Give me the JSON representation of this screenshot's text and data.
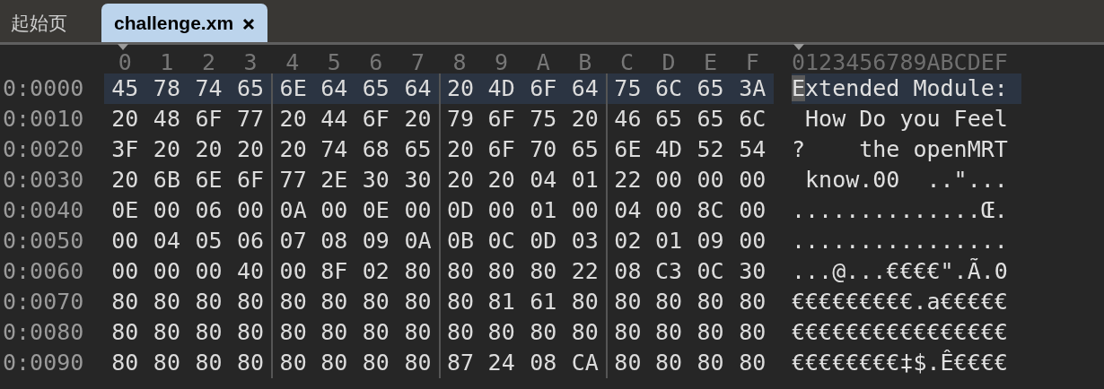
{
  "tabs": [
    {
      "label": "起始页",
      "selected": false,
      "closable": false
    },
    {
      "label": "challenge.xm",
      "selected": true,
      "closable": true
    }
  ],
  "column_headers": [
    "0",
    "1",
    "2",
    "3",
    "4",
    "5",
    "6",
    "7",
    "8",
    "9",
    "A",
    "B",
    "C",
    "D",
    "E",
    "F"
  ],
  "ascii_header": "0123456789ABCDEF",
  "rows": [
    {
      "address": "0:0000",
      "bytes": [
        "45",
        "78",
        "74",
        "65",
        "6E",
        "64",
        "65",
        "64",
        "20",
        "4D",
        "6F",
        "64",
        "75",
        "6C",
        "65",
        "3A"
      ],
      "ascii": "Extended Module:",
      "selected": true,
      "cursor": true
    },
    {
      "address": "0:0010",
      "bytes": [
        "20",
        "48",
        "6F",
        "77",
        "20",
        "44",
        "6F",
        "20",
        "79",
        "6F",
        "75",
        "20",
        "46",
        "65",
        "65",
        "6C"
      ],
      "ascii": " How Do you Feel",
      "selected": false,
      "cursor": false
    },
    {
      "address": "0:0020",
      "bytes": [
        "3F",
        "20",
        "20",
        "20",
        "20",
        "74",
        "68",
        "65",
        "20",
        "6F",
        "70",
        "65",
        "6E",
        "4D",
        "52",
        "54"
      ],
      "ascii": "?    the openMRT",
      "selected": false,
      "cursor": false
    },
    {
      "address": "0:0030",
      "bytes": [
        "20",
        "6B",
        "6E",
        "6F",
        "77",
        "2E",
        "30",
        "30",
        "20",
        "20",
        "04",
        "01",
        "22",
        "00",
        "00",
        "00"
      ],
      "ascii": " know.00  ..\"...",
      "selected": false,
      "cursor": false
    },
    {
      "address": "0:0040",
      "bytes": [
        "0E",
        "00",
        "06",
        "00",
        "0A",
        "00",
        "0E",
        "00",
        "0D",
        "00",
        "01",
        "00",
        "04",
        "00",
        "8C",
        "00"
      ],
      "ascii": "..............Œ.",
      "selected": false,
      "cursor": false
    },
    {
      "address": "0:0050",
      "bytes": [
        "00",
        "04",
        "05",
        "06",
        "07",
        "08",
        "09",
        "0A",
        "0B",
        "0C",
        "0D",
        "03",
        "02",
        "01",
        "09",
        "00"
      ],
      "ascii": "................",
      "selected": false,
      "cursor": false
    },
    {
      "address": "0:0060",
      "bytes": [
        "00",
        "00",
        "00",
        "40",
        "00",
        "8F",
        "02",
        "80",
        "80",
        "80",
        "80",
        "22",
        "08",
        "C3",
        "0C",
        "30"
      ],
      "ascii": "...@...€€€€\".Ã.0",
      "selected": false,
      "cursor": false
    },
    {
      "address": "0:0070",
      "bytes": [
        "80",
        "80",
        "80",
        "80",
        "80",
        "80",
        "80",
        "80",
        "80",
        "81",
        "61",
        "80",
        "80",
        "80",
        "80",
        "80"
      ],
      "ascii": "€€€€€€€€€.a€€€€€",
      "selected": false,
      "cursor": false
    },
    {
      "address": "0:0080",
      "bytes": [
        "80",
        "80",
        "80",
        "80",
        "80",
        "80",
        "80",
        "80",
        "80",
        "80",
        "80",
        "80",
        "80",
        "80",
        "80",
        "80"
      ],
      "ascii": "€€€€€€€€€€€€€€€€",
      "selected": false,
      "cursor": false
    },
    {
      "address": "0:0090",
      "bytes": [
        "80",
        "80",
        "80",
        "80",
        "80",
        "80",
        "80",
        "80",
        "87",
        "24",
        "08",
        "CA",
        "80",
        "80",
        "80",
        "80"
      ],
      "ascii": "€€€€€€€€‡$.Ê€€€€",
      "selected": false,
      "cursor": false
    }
  ]
}
